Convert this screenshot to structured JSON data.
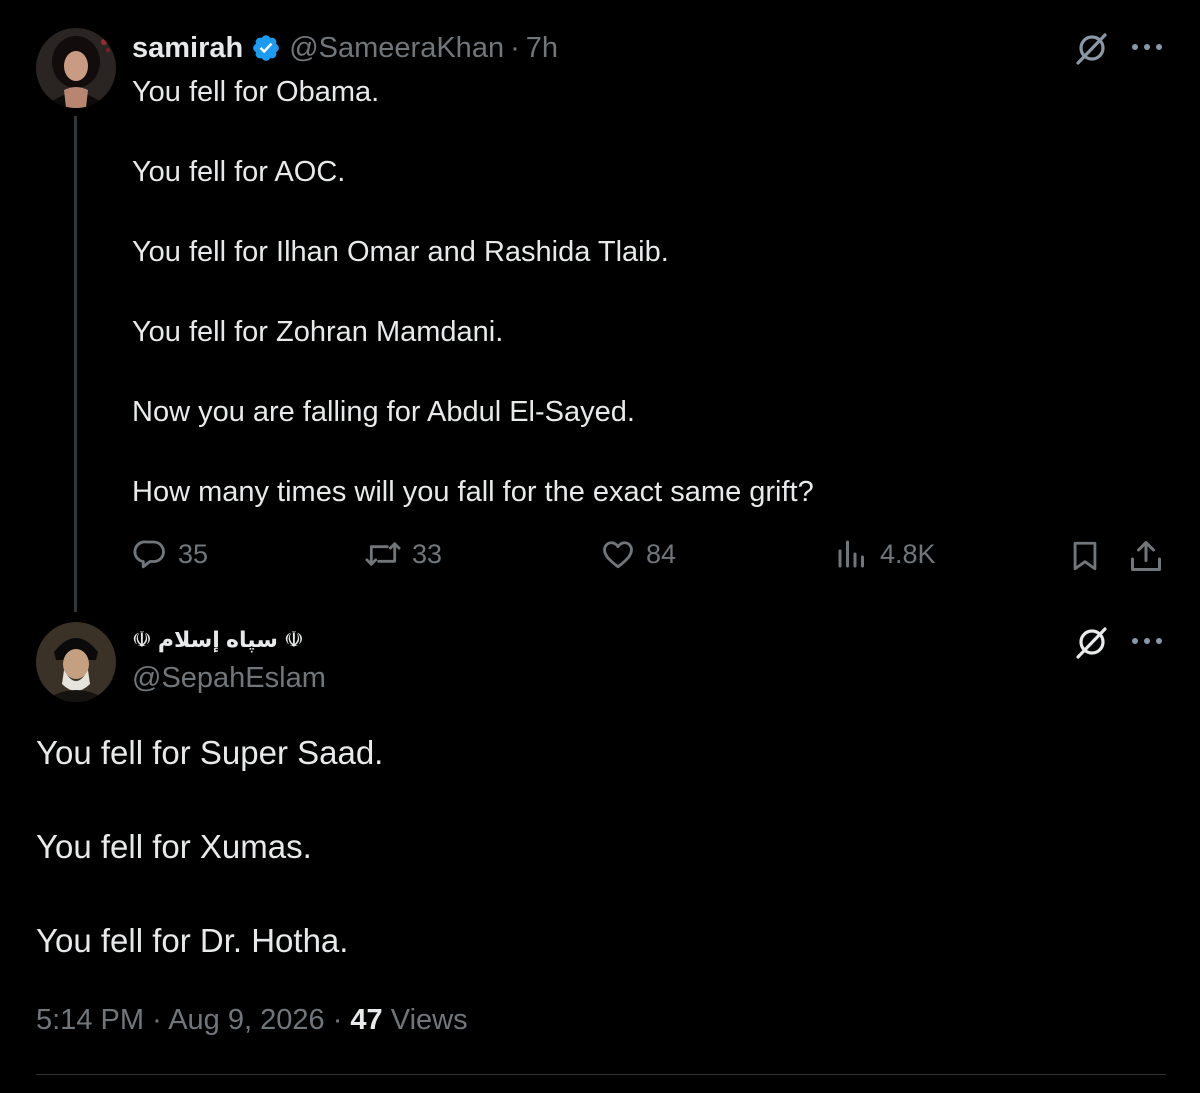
{
  "colors": {
    "background": "#000000",
    "text": "#e7e9ea",
    "muted": "#71767b",
    "verified": "#1d9bf0",
    "divider": "#2f3336"
  },
  "tweet": {
    "author": {
      "display_name": "samirah",
      "handle": "@SameeraKhan",
      "verified": true
    },
    "separator": "·",
    "time": "7h",
    "lines": [
      "You fell for Obama.",
      "You fell for AOC.",
      "You fell for Ilhan Omar and Rashida Tlaib.",
      "You fell for Zohran Mamdani.",
      "Now you are falling for Abdul El-Sayed.",
      "How many times will you fall for the exact same grift?"
    ],
    "stats": {
      "replies": "35",
      "reposts": "33",
      "likes": "84",
      "views": "4.8K"
    },
    "icons": [
      "grok-icon",
      "more-icon",
      "reply-icon",
      "repost-icon",
      "like-icon",
      "views-icon",
      "bookmark-icon",
      "share-icon"
    ]
  },
  "reply": {
    "author": {
      "display_name": "☫ سپاه إسلام ☫",
      "handle": "@SepahEslam"
    },
    "lines": [
      "You fell for Super Saad.",
      "You fell for Xumas.",
      "You fell for Dr. Hotha."
    ],
    "meta": {
      "time": "5:14 PM",
      "separator": "·",
      "date": "Aug 9, 2026",
      "views_count": "47",
      "views_label": "Views"
    }
  }
}
